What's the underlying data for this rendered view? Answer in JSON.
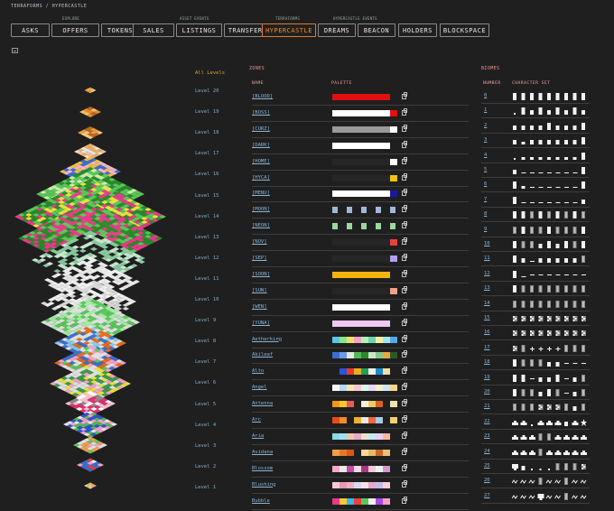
{
  "breadcrumb": {
    "root": "TERRAFORMS",
    "sep": "/",
    "current": "HYPERCASTLE"
  },
  "nav": {
    "groups": [
      "EXPLORE",
      "ASSET EVENTS",
      "TERRAFORMS",
      "HYPERCASTLE EVENTS"
    ],
    "buttons": [
      "ASKS",
      "OFFERS",
      "TOKENS",
      "SALES",
      "LISTINGS",
      "TRANSFERS",
      "HYPERCASTLE",
      "DREAMS",
      "BEACON",
      "HOLDERS",
      "BLOCKSPACE"
    ],
    "active": "HYPERCASTLE"
  },
  "levels": {
    "all": "All Levels",
    "items": [
      "Level 20",
      "Level 19",
      "Level 18",
      "Level 17",
      "Level 16",
      "Level 15",
      "Level 14",
      "Level 13",
      "Level 12",
      "Level 11",
      "Level 10",
      "Level 9",
      "Level 8",
      "Level 7",
      "Level 6",
      "Level 5",
      "Level 4",
      "Level 3",
      "Level 2",
      "Level 1"
    ]
  },
  "zones": {
    "title": "ZONES",
    "col_name": "NAME",
    "col_palette": "PALETTE",
    "rows": [
      {
        "name": "[BLOOD]",
        "colors": [
          "#e01010",
          "#e01010",
          "#e01010",
          "#e01010",
          "#e01010",
          "#e01010",
          "#e01010",
          "#e01010",
          "#1f1f1f"
        ],
        "style": "bar"
      },
      {
        "name": "[BOSS]",
        "colors": [
          "#ffffff",
          "#ffffff",
          "#ffffff",
          "#ffffff",
          "#ffffff",
          "#ffffff",
          "#ffffff",
          "#ffffff",
          "#e01010"
        ],
        "style": "bar"
      },
      {
        "name": "[CURZ]",
        "colors": [
          "#9a9a9a",
          "#9a9a9a",
          "#9a9a9a",
          "#9a9a9a",
          "#9a9a9a",
          "#9a9a9a",
          "#9a9a9a",
          "#9a9a9a",
          "#ffffff"
        ],
        "style": "bar"
      },
      {
        "name": "[DARK]",
        "colors": [
          "#ffffff",
          "#ffffff",
          "#ffffff",
          "#ffffff",
          "#ffffff",
          "#ffffff",
          "#ffffff",
          "#ffffff",
          "#1f1f1f"
        ],
        "style": "bar"
      },
      {
        "name": "[HOME]",
        "colors": [
          "#262626",
          "#262626",
          "#262626",
          "#262626",
          "#262626",
          "#262626",
          "#262626",
          "#262626",
          "#ffffff"
        ],
        "style": "bar"
      },
      {
        "name": "[HYCA]",
        "colors": [
          "#262626",
          "#262626",
          "#262626",
          "#262626",
          "#262626",
          "#262626",
          "#262626",
          "#262626",
          "#f4c20d"
        ],
        "style": "bar"
      },
      {
        "name": "[MENU]",
        "colors": [
          "#ffffff",
          "#ffffff",
          "#ffffff",
          "#ffffff",
          "#ffffff",
          "#ffffff",
          "#ffffff",
          "#ffffff",
          "#1818a8"
        ],
        "style": "bar"
      },
      {
        "name": "[MOON]",
        "colors": [
          "#9fb8d8",
          "#1f1f1f",
          "#9fb8d8",
          "#1f1f1f",
          "#9fb8d8",
          "#1f1f1f",
          "#9fb8d8",
          "#1f1f1f",
          "#9fb8d8"
        ],
        "style": "dots"
      },
      {
        "name": "[NEON]",
        "colors": [
          "#9ad8a0",
          "#1f1f1f",
          "#9ad8a0",
          "#1f1f1f",
          "#9ad8a0",
          "#1f1f1f",
          "#9ad8a0",
          "#1f1f1f",
          "#9ad8a0"
        ],
        "style": "dots"
      },
      {
        "name": "[NOV]",
        "colors": [
          "#262626",
          "#262626",
          "#262626",
          "#262626",
          "#262626",
          "#262626",
          "#262626",
          "#262626",
          "#e84040"
        ],
        "style": "bar"
      },
      {
        "name": "[SEP]",
        "colors": [
          "#262626",
          "#262626",
          "#262626",
          "#262626",
          "#262626",
          "#262626",
          "#262626",
          "#262626",
          "#b59cf0"
        ],
        "style": "bar"
      },
      {
        "name": "[SOON]",
        "colors": [
          "#f5b312",
          "#f5b312",
          "#f5b312",
          "#f5b312",
          "#f5b312",
          "#f5b312",
          "#f5b312",
          "#f5b312",
          "#1f1f1f"
        ],
        "style": "bar"
      },
      {
        "name": "[SUN]",
        "colors": [
          "#262626",
          "#262626",
          "#262626",
          "#262626",
          "#262626",
          "#262626",
          "#262626",
          "#262626",
          "#f0a08a"
        ],
        "style": "bar"
      },
      {
        "name": "[WEN]",
        "colors": [
          "#ffffff",
          "#ffffff",
          "#ffffff",
          "#ffffff",
          "#ffffff",
          "#ffffff",
          "#ffffff",
          "#ffffff",
          "#1f1f1f"
        ],
        "style": "bar"
      },
      {
        "name": "[YUNA]",
        "colors": [
          "#f0c8f0",
          "#f0c8f0",
          "#f0c8f0",
          "#f0c8f0",
          "#f0c8f0",
          "#f0c8f0",
          "#f0c8f0",
          "#f0c8f0",
          "#1f1f1f"
        ],
        "style": "bar"
      },
      {
        "name": "Aetherking",
        "colors": [
          "#58c8e8",
          "#88e888",
          "#f0e068",
          "#f8a0c8",
          "#b0f0b8",
          "#68d8a8",
          "#f0f0a0",
          "#a0e8f0",
          "#58a8e8"
        ],
        "style": "bar"
      },
      {
        "name": "Akileaf",
        "colors": [
          "#3b6fd0",
          "#6a9ae8",
          "#e8e8e8",
          "#58b858",
          "#2a8a2a",
          "#c8e8c8",
          "#88c888",
          "#e8a840",
          "#2a5a2a"
        ],
        "style": "bar"
      },
      {
        "name": "Alto",
        "colors": [
          "#1f1f1f",
          "#2a55d8",
          "#e83a30",
          "#e8b020",
          "#20a050",
          "#f0f0f0",
          "#1e88d0",
          "#f0e0a0",
          "#1f1f1f"
        ],
        "style": "bar"
      },
      {
        "name": "Angel",
        "colors": [
          "#f8f8f8",
          "#b8d8f8",
          "#f8e8a8",
          "#f8c8d8",
          "#d8f8e8",
          "#e8d8f8",
          "#f8f0c8",
          "#c8e8f8",
          "#f8d888"
        ],
        "style": "bar"
      },
      {
        "name": "Antenna",
        "colors": [
          "#f09818",
          "#f8c830",
          "#e85a5a",
          "#1f1f1f",
          "#f8f0d8",
          "#f0c868",
          "#d86020",
          "#1f1f1f",
          "#f0e0b0"
        ],
        "style": "bar"
      },
      {
        "name": "Arc",
        "colors": [
          "#e84a1a",
          "#f08a2a",
          "#1f1f1f",
          "#f0b030",
          "#e8e8e8",
          "#f06a3a",
          "#a8c8e8",
          "#1f1f1f",
          "#f0d070"
        ],
        "style": "bar"
      },
      {
        "name": "Aria",
        "colors": [
          "#8ad8e8",
          "#a0e0f0",
          "#f0c8a8",
          "#e8a8c8",
          "#f0e0c8",
          "#c8e8f0",
          "#e8d0f0",
          "#f8b8a0",
          "#1f1f1f"
        ],
        "style": "bar"
      },
      {
        "name": "Avidana",
        "colors": [
          "#f0a048",
          "#e87828",
          "#d85818",
          "#1f1f1f",
          "#f8d898",
          "#e8b868",
          "#c86828",
          "#f0c078",
          "#1f1f1f"
        ],
        "style": "bar"
      },
      {
        "name": "Blossom",
        "colors": [
          "#f8a8c8",
          "#e8e8e8",
          "#c848a8",
          "#f8d8e8",
          "#a83888",
          "#f8c8d8",
          "#e8f0f8",
          "#d898c8",
          "#1f1f1f"
        ],
        "style": "bar"
      },
      {
        "name": "Blushing",
        "colors": [
          "#f8c8d8",
          "#e898b8",
          "#f0b0c8",
          "#d8d8f0",
          "#f8e0e8",
          "#e8a8d0",
          "#c8b8e8",
          "#f8d0e0",
          "#1f1f1f"
        ],
        "style": "bar"
      },
      {
        "name": "Bubble",
        "colors": [
          "#e83a8a",
          "#f8c830",
          "#3ab8e8",
          "#e8403a",
          "#58c858",
          "#f0f0f0",
          "#a848e8",
          "#f8a0c8",
          "#1f1f1f"
        ],
        "style": "bar"
      }
    ]
  },
  "biomes": {
    "title": "BIOMES",
    "col_number": "NUMBER",
    "col_charset": "CHARACTER SET",
    "rows": [
      {
        "number": "0",
        "glyphs": "tall,tall,tall,tall,tall,tall,tall,tall,tall"
      },
      {
        "number": "1",
        "glyphs": "dot,tall,half,tall,half,tall,half,tall,half"
      },
      {
        "number": "2",
        "glyphs": "half,half,half,half,tall,half,half,half,tall"
      },
      {
        "number": "3",
        "glyphs": "half,low,half,half,half,half,half,half,tall"
      },
      {
        "number": "4",
        "glyphs": "dot,low,low,low,low,low,low,low,tall"
      },
      {
        "number": "5",
        "glyphs": "half,line,line,line,line,line,line,line,tall"
      },
      {
        "number": "6",
        "glyphs": "tall,low,line,line,line,line,line,line,tall"
      },
      {
        "number": "7",
        "glyphs": "tall,line,line,line,line,line,line,line,half"
      },
      {
        "number": "8",
        "glyphs": "tall,tall,grey,tall,grey,tall,grey,tall,grey"
      },
      {
        "number": "9",
        "glyphs": "grey,tall,grey,grey,tall,grey,grey,grey,tall"
      },
      {
        "number": "10",
        "glyphs": "tall,grey,grey,half,tall,half,tall,grey,tall"
      },
      {
        "number": "11",
        "glyphs": "tall,half,line,half,half,half,half,half,grey"
      },
      {
        "number": "12",
        "glyphs": "tall,line,dash,dash,dash,dash,dash,dash,dash"
      },
      {
        "number": "13",
        "glyphs": "tall,grey,grey,grey,grey,grey,grey,grey,grey"
      },
      {
        "number": "14",
        "glyphs": "grey,grey,grey,grey,grey,grey,grey,grey,grey"
      },
      {
        "number": "15",
        "glyphs": "check,check,check,check,check,check,check,check,check"
      },
      {
        "number": "16",
        "glyphs": "check,check,check,check,check,check,check,check,check"
      },
      {
        "number": "17",
        "glyphs": "check,grey,plus,plus,plus,plus,grey,grey,grey"
      },
      {
        "number": "18",
        "glyphs": "tall,grey,grey,grey,half,half,dash,dash,dash"
      },
      {
        "number": "19",
        "glyphs": "tall,tall,dash,half,half,tall,dash,half,grey"
      },
      {
        "number": "20",
        "glyphs": "tall,grey,grey,half,tall,grey,dash,half,grey"
      },
      {
        "number": "21",
        "glyphs": "grey,grey,grey,check,check,check,grey,half,grey"
      },
      {
        "number": "22",
        "glyphs": "car,car,dot,car,car,car,half,car,star"
      },
      {
        "number": "23",
        "glyphs": "car,car,car,grey,grey,car,car,car,car"
      },
      {
        "number": "24",
        "glyphs": "car,car,car,grey,car,car,car,car,car"
      },
      {
        "number": "25",
        "glyphs": "pc,half,dot,dot,dot,grey,grey,grey,check"
      },
      {
        "number": "26",
        "glyphs": "wave,wave,wave,grey,wave,wave,grey,wave,wave"
      },
      {
        "number": "27",
        "glyphs": "wave,wave,wave,pc,wave,wave,grey,wave,wave"
      }
    ]
  }
}
